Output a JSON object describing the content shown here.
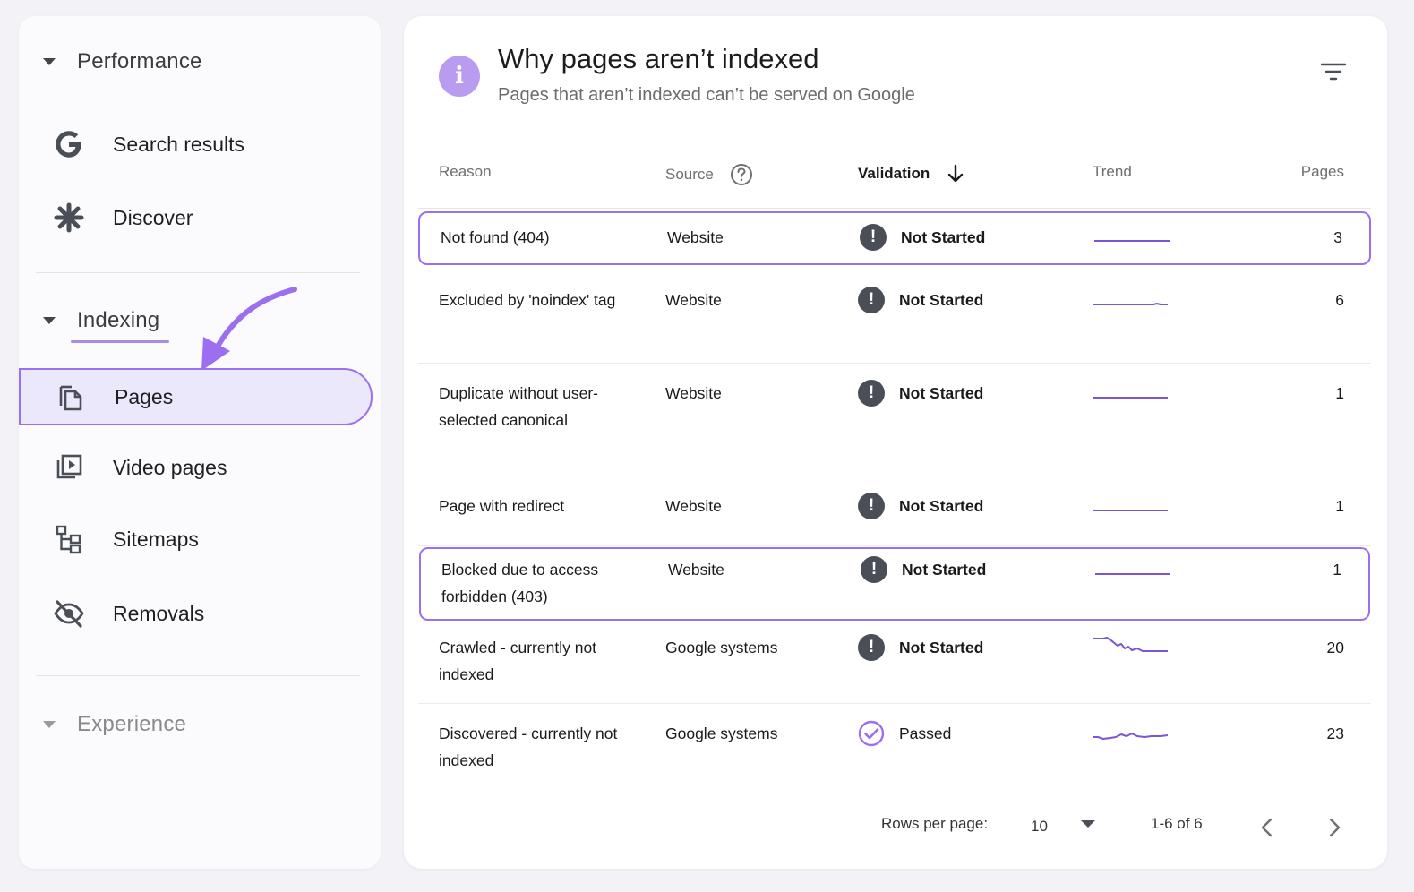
{
  "sidebar": {
    "performance": {
      "label": "Performance",
      "items": [
        {
          "label": "Search results",
          "icon": "google-g-icon"
        },
        {
          "label": "Discover",
          "icon": "asterisk-icon"
        }
      ]
    },
    "indexing": {
      "label": "Indexing",
      "items": [
        {
          "label": "Pages",
          "icon": "pages-icon",
          "active": true
        },
        {
          "label": "Video pages",
          "icon": "video-pages-icon"
        },
        {
          "label": "Sitemaps",
          "icon": "sitemap-icon"
        },
        {
          "label": "Removals",
          "icon": "eye-off-icon"
        }
      ]
    },
    "experience": {
      "label": "Experience"
    }
  },
  "main": {
    "title": "Why pages aren’t indexed",
    "subtitle": "Pages that aren’t indexed can’t be served on Google",
    "info_icon_glyph": "i",
    "columns": {
      "reason": "Reason",
      "source": "Source",
      "validation": "Validation",
      "trend": "Trend",
      "pages": "Pages"
    },
    "rows": [
      {
        "reason": "Not found (404)",
        "source": "Website",
        "validation": "Not Started",
        "pages": "3",
        "highlighted": true,
        "trend": "flat"
      },
      {
        "reason": "Excluded by 'noindex' tag",
        "source": "Website",
        "validation": "Not Started",
        "pages": "6",
        "highlighted": false,
        "trend": "flat-bump"
      },
      {
        "reason": "Duplicate without user-selected canonical",
        "source": "Website",
        "validation": "Not Started",
        "pages": "1",
        "highlighted": false,
        "trend": "flat"
      },
      {
        "reason": "Page with redirect",
        "source": "Website",
        "validation": "Not Started",
        "pages": "1",
        "highlighted": false,
        "trend": "flat"
      },
      {
        "reason": "Blocked due to access forbidden (403)",
        "source": "Website",
        "validation": "Not Started",
        "pages": "1",
        "highlighted": true,
        "trend": "flat"
      },
      {
        "reason": "Crawled - currently not indexed",
        "source": "Google systems",
        "validation": "Not Started",
        "pages": "20",
        "highlighted": false,
        "trend": "decline"
      },
      {
        "reason": "Discovered - currently not indexed",
        "source": "Google systems",
        "validation": "Passed",
        "pages": "23",
        "highlighted": false,
        "trend": "wavy"
      }
    ],
    "pagination": {
      "rows_per_page_label": "Rows per page:",
      "rows_per_page_value": "10",
      "range": "1-6 of 6"
    }
  },
  "colors": {
    "accent": "#9b6ff0",
    "info_badge": "#b99cf0",
    "status_dark": "#4a4f57",
    "sparkline": "#7a55d6"
  }
}
